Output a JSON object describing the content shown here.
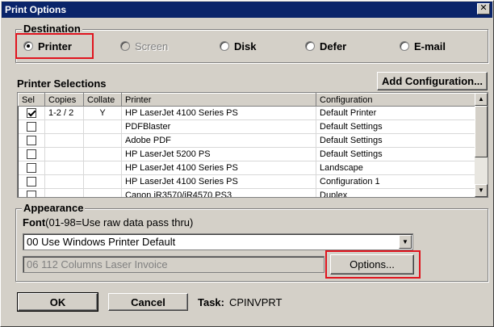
{
  "window": {
    "title": "Print Options",
    "close_glyph": "✕"
  },
  "destination": {
    "label": "Destination",
    "options": [
      {
        "label": "Printer",
        "checked": true,
        "disabled": false
      },
      {
        "label": "Screen",
        "checked": false,
        "disabled": true
      },
      {
        "label": "Disk",
        "checked": false,
        "disabled": false
      },
      {
        "label": "Defer",
        "checked": false,
        "disabled": false
      },
      {
        "label": "E-mail",
        "checked": false,
        "disabled": false
      }
    ]
  },
  "printer_selections": {
    "label": "Printer Selections",
    "add_configuration_label": "Add Configuration...",
    "columns": [
      "Sel",
      "Copies",
      "Collate",
      "Printer",
      "Configuration"
    ],
    "rows": [
      {
        "sel": true,
        "copies": "1-2 / 2",
        "collate": "Y",
        "printer": "HP LaserJet 4100 Series PS",
        "configuration": "Default Printer"
      },
      {
        "sel": false,
        "copies": "",
        "collate": "",
        "printer": "PDFBlaster",
        "configuration": "Default Settings"
      },
      {
        "sel": false,
        "copies": "",
        "collate": "",
        "printer": "Adobe PDF",
        "configuration": "Default Settings"
      },
      {
        "sel": false,
        "copies": "",
        "collate": "",
        "printer": "HP LaserJet 5200 PS",
        "configuration": "Default Settings"
      },
      {
        "sel": false,
        "copies": "",
        "collate": "",
        "printer": "HP LaserJet 4100 Series PS",
        "configuration": "Landscape"
      },
      {
        "sel": false,
        "copies": "",
        "collate": "",
        "printer": "HP LaserJet 4100 Series PS",
        "configuration": "Configuration 1"
      },
      {
        "sel": false,
        "copies": "",
        "collate": "",
        "printer": "Canon iR3570/iR4570 PS3",
        "configuration": "Duplex"
      }
    ]
  },
  "appearance": {
    "label": "Appearance",
    "font_label": "Font",
    "font_hint": "(01-98=Use raw data pass thru)",
    "font_value": "00 Use Windows Printer Default",
    "form_value": "06 112 Columns Laser Invoice",
    "options_label": "Options..."
  },
  "footer": {
    "ok_label": "OK",
    "cancel_label": "Cancel",
    "task_label": "Task:",
    "task_value": "CPINVPRT"
  },
  "colors": {
    "highlight": "#e0141e",
    "titlebar": "#0a246a",
    "face": "#d4d0c8"
  }
}
